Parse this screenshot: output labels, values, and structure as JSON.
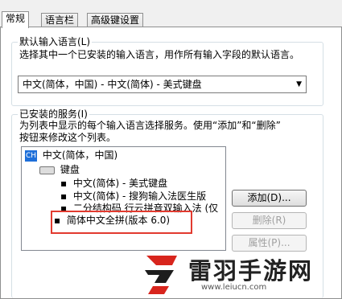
{
  "tabs": [
    "常规",
    "语言栏",
    "高级键设置"
  ],
  "default_language": {
    "legend": "默认输入语言(L)",
    "description": "选择其中一个已安装的输入语言，用作所有输入字段的默认语言。",
    "selected": "中文(简体，中国) - 中文(简体) - 美式键盘"
  },
  "installed_services": {
    "legend": "已安装的服务(I)",
    "description_line1": "为列表中显示的每个输入语言选择服务。使用“添加”和“删除”",
    "description_line2": "按钮来修改这个列表。",
    "tree": {
      "language_badge": "CH",
      "language": "中文(简体，中国)",
      "category": "键盘",
      "items": [
        "中文(简体) - 美式键盘",
        "中文(简体) - 搜狗输入法医生版",
        "二分结构码 行云拼音双输入法 (仅",
        "简体中文全拼(版本 6.0)"
      ]
    },
    "buttons": {
      "add": "添加(D)...",
      "remove": "删除(R)",
      "properties": "属性(P)..."
    }
  },
  "watermark": {
    "name": "雷羽手游网",
    "url": "www.leiucn.com"
  }
}
